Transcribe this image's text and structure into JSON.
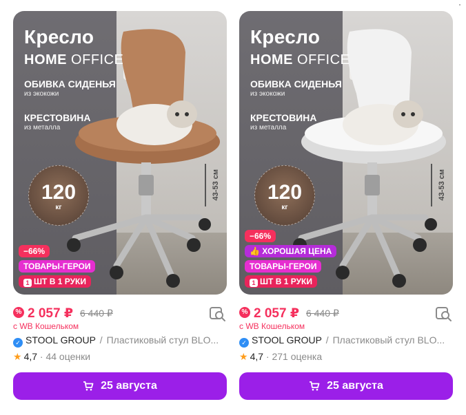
{
  "cards": [
    {
      "promo": {
        "title": "Кресло",
        "subtitle_bold": "HOME",
        "subtitle_rest": " OFFICE",
        "feature1": "ОБИВКА СИДЕНЬЯ",
        "feature1_sub": "из экокожи",
        "feature2": "КРЕСТОВИНА",
        "feature2_sub": "из металла",
        "load_value": "120",
        "load_unit": "кг",
        "height_range": "43-53 см",
        "seat_color": "#b8825c"
      },
      "badges": {
        "discount": "−66%",
        "good_price": "",
        "hero": "ТОВАРЫ-ГЕРОИ",
        "limit_icon": "1",
        "limit": "ШТ В 1 РУКИ"
      },
      "price": "2 057 ₽",
      "old_price": "6 440 ₽",
      "wallet_note": "с WB Кошельком",
      "brand": "STOOL GROUP",
      "product_name": "Пластиковый стул BLO...",
      "rating": "4,7",
      "reviews": "· 44 оценки",
      "delivery": "25 августа"
    },
    {
      "promo": {
        "title": "Кресло",
        "subtitle_bold": "HOME",
        "subtitle_rest": " OFFICE",
        "feature1": "ОБИВКА СИДЕНЬЯ",
        "feature1_sub": "из экокожи",
        "feature2": "КРЕСТОВИНА",
        "feature2_sub": "из металла",
        "load_value": "120",
        "load_unit": "кг",
        "height_range": "43-53 см",
        "seat_color": "#f2f2f2"
      },
      "badges": {
        "discount": "−66%",
        "good_price": "ХОРОШАЯ ЦЕНА",
        "hero": "ТОВАРЫ-ГЕРОИ",
        "limit_icon": "1",
        "limit": "ШТ В 1 РУКИ"
      },
      "price": "2 057 ₽",
      "old_price": "6 440 ₽",
      "wallet_note": "с WB Кошельком",
      "brand": "STOOL GROUP",
      "product_name": "Пластиковый стул BLO...",
      "rating": "4,7",
      "reviews": "· 271 оценка",
      "delivery": "25 августа"
    }
  ],
  "colors": {
    "accent_purple": "#9b1fe8",
    "price_red": "#f5305d",
    "hero_pink": "#e62ed0",
    "good_price_purple": "#b52cd9",
    "star_orange": "#ff9d1c",
    "verified_blue": "#2f8ef5"
  },
  "icons": [
    "wallet-discount-icon",
    "similar-search-icon",
    "verified-icon",
    "star-icon",
    "cart-icon"
  ]
}
